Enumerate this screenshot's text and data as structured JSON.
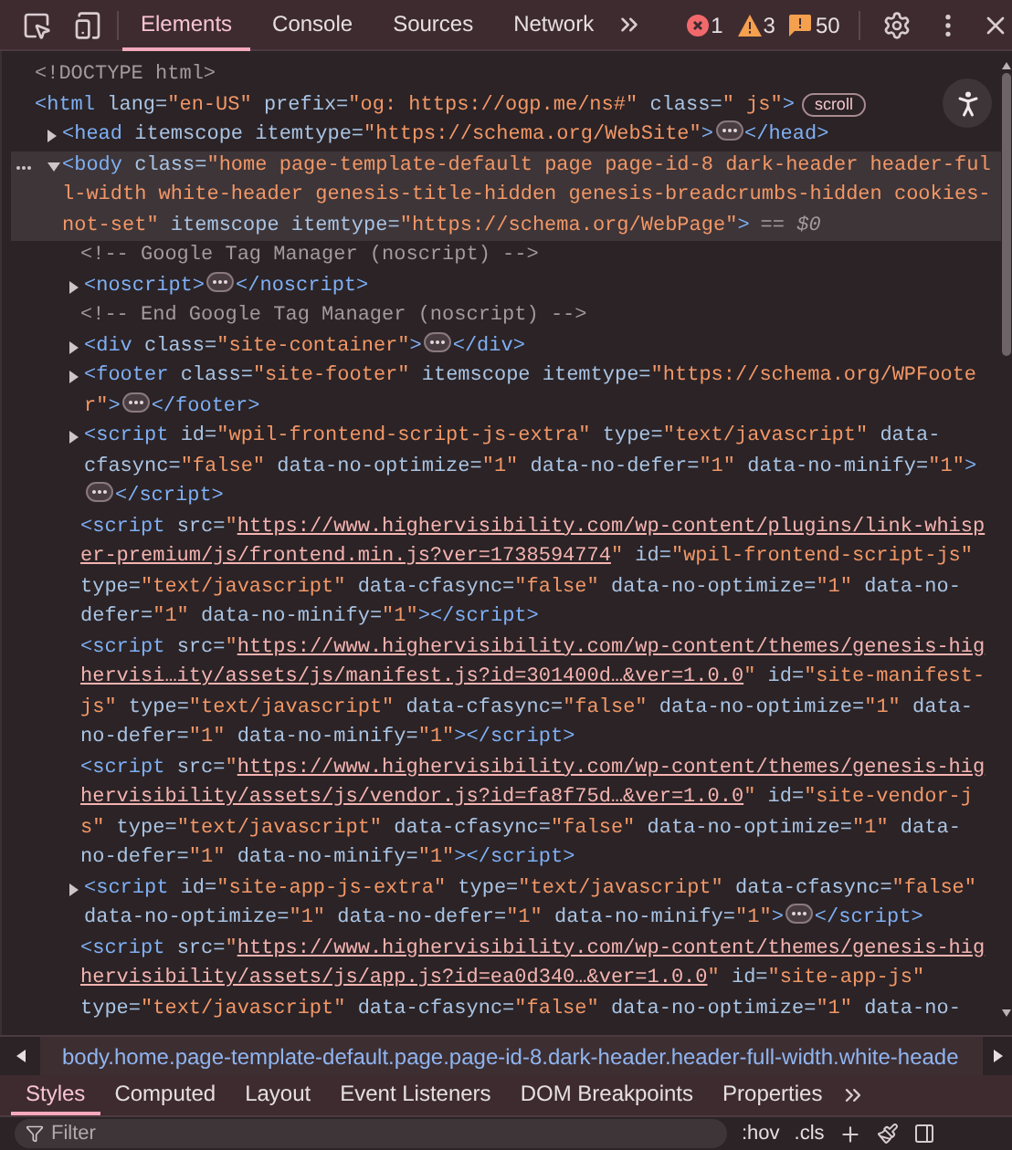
{
  "toolbar": {
    "tabs": [
      {
        "label": "Elements",
        "selected": true
      },
      {
        "label": "Console",
        "selected": false
      },
      {
        "label": "Sources",
        "selected": false
      },
      {
        "label": "Network",
        "selected": false
      }
    ],
    "errors": "1",
    "warnings": "3",
    "messages": "50"
  },
  "dom_tree": [
    {
      "selected": false,
      "tokens": [
        {
          "kind": "comment",
          "text": "<!DOCTYPE html>"
        }
      ]
    },
    {
      "selected": false,
      "tokens": [
        {
          "kind": "tag",
          "text": "<html"
        },
        {
          "kind": "attr",
          "text": " lang="
        },
        {
          "kind": "value",
          "text": "\"en-US\""
        },
        {
          "kind": "attr",
          "text": " prefix="
        },
        {
          "kind": "value",
          "text": "\"og: https://ogp.me/ns#\""
        },
        {
          "kind": "attr",
          "text": " class="
        },
        {
          "kind": "value",
          "text": "\" js\""
        },
        {
          "kind": "tag",
          "text": ">"
        },
        {
          "kind": "badge",
          "text": "scroll"
        }
      ],
      "children": [
        {
          "selected": false,
          "expanded": false,
          "tokens": [
            {
              "kind": "tag",
              "text": "<head"
            },
            {
              "kind": "attr",
              "text": " itemscope itemtype="
            },
            {
              "kind": "value",
              "text": "\"https://schema.org/WebSite\""
            },
            {
              "kind": "tag",
              "text": ">"
            },
            {
              "kind": "ellipsis"
            },
            {
              "kind": "tag",
              "text": "</head>"
            }
          ]
        },
        {
          "selected": true,
          "expanded": true,
          "tokens": [
            {
              "kind": "tag",
              "text": "<body"
            },
            {
              "kind": "attr",
              "text": " class="
            },
            {
              "kind": "value",
              "text": "\"home page-template-default page page-id-8 dark-header header-full-width white-header genesis-title-hidden genesis-breadcrumbs-hidden cookies-not-set\""
            },
            {
              "kind": "attr",
              "text": " itemscope itemtype="
            },
            {
              "kind": "value",
              "text": "\"https://schema.org/WebPage\""
            },
            {
              "kind": "tag",
              "text": ">"
            },
            {
              "kind": "marker",
              "text": "== $0"
            }
          ],
          "children": [
            {
              "selected": false,
              "tokens": [
                {
                  "kind": "comment",
                  "text": "<!-- Google Tag Manager (noscript) -->"
                }
              ]
            },
            {
              "selected": false,
              "expanded": false,
              "tokens": [
                {
                  "kind": "tag",
                  "text": "<noscript>"
                },
                {
                  "kind": "ellipsis"
                },
                {
                  "kind": "tag",
                  "text": "</noscript>"
                }
              ]
            },
            {
              "selected": false,
              "tokens": [
                {
                  "kind": "comment",
                  "text": "<!-- End Google Tag Manager (noscript) -->"
                }
              ]
            },
            {
              "selected": false,
              "expanded": false,
              "tokens": [
                {
                  "kind": "tag",
                  "text": "<div"
                },
                {
                  "kind": "attr",
                  "text": " class="
                },
                {
                  "kind": "value",
                  "text": "\"site-container\""
                },
                {
                  "kind": "tag",
                  "text": ">"
                },
                {
                  "kind": "ellipsis"
                },
                {
                  "kind": "tag",
                  "text": "</div>"
                }
              ]
            },
            {
              "selected": false,
              "expanded": false,
              "tokens": [
                {
                  "kind": "tag",
                  "text": "<footer"
                },
                {
                  "kind": "attr",
                  "text": " class="
                },
                {
                  "kind": "value",
                  "text": "\"site-footer\""
                },
                {
                  "kind": "attr",
                  "text": " itemscope itemtype="
                },
                {
                  "kind": "value",
                  "text": "\"https://schema.org/WPFooter\""
                },
                {
                  "kind": "tag",
                  "text": ">"
                },
                {
                  "kind": "ellipsis"
                },
                {
                  "kind": "tag",
                  "text": "</footer>"
                }
              ]
            },
            {
              "selected": false,
              "expanded": false,
              "tokens": [
                {
                  "kind": "tag",
                  "text": "<script"
                },
                {
                  "kind": "attr",
                  "text": " id="
                },
                {
                  "kind": "value",
                  "text": "\"wpil-frontend-script-js-extra\""
                },
                {
                  "kind": "attr",
                  "text": " type="
                },
                {
                  "kind": "value",
                  "text": "\"text/javascript\""
                },
                {
                  "kind": "attr",
                  "text": " data-cfasync="
                },
                {
                  "kind": "value",
                  "text": "\"false\""
                },
                {
                  "kind": "attr",
                  "text": " data-no-optimize="
                },
                {
                  "kind": "value",
                  "text": "\"1\""
                },
                {
                  "kind": "attr",
                  "text": " data-no-defer="
                },
                {
                  "kind": "value",
                  "text": "\"1\""
                },
                {
                  "kind": "attr",
                  "text": " data-no-minify="
                },
                {
                  "kind": "value",
                  "text": "\"1\""
                },
                {
                  "kind": "tag",
                  "text": ">"
                },
                {
                  "kind": "ellipsis"
                },
                {
                  "kind": "tag",
                  "text": "</script>"
                }
              ]
            },
            {
              "selected": false,
              "tokens": [
                {
                  "kind": "tag",
                  "text": "<script"
                },
                {
                  "kind": "attr",
                  "text": " src="
                },
                {
                  "kind": "value",
                  "text": "\""
                },
                {
                  "kind": "link",
                  "text": "https://www.highervisibility.com/wp-content/plugins/link-whisper-premium/js/frontend.min.js?ver=1738594774"
                },
                {
                  "kind": "value",
                  "text": "\""
                },
                {
                  "kind": "attr",
                  "text": " id="
                },
                {
                  "kind": "value",
                  "text": "\"wpil-frontend-script-js\""
                },
                {
                  "kind": "attr",
                  "text": " type="
                },
                {
                  "kind": "value",
                  "text": "\"text/javascript\""
                },
                {
                  "kind": "attr",
                  "text": " data-cfasync="
                },
                {
                  "kind": "value",
                  "text": "\"false\""
                },
                {
                  "kind": "attr",
                  "text": " data-no-optimize="
                },
                {
                  "kind": "value",
                  "text": "\"1\""
                },
                {
                  "kind": "attr",
                  "text": " data-no-defer="
                },
                {
                  "kind": "value",
                  "text": "\"1\""
                },
                {
                  "kind": "attr",
                  "text": " data-no-minify="
                },
                {
                  "kind": "value",
                  "text": "\"1\""
                },
                {
                  "kind": "tag",
                  "text": "></script>"
                }
              ]
            },
            {
              "selected": false,
              "tokens": [
                {
                  "kind": "tag",
                  "text": "<script"
                },
                {
                  "kind": "attr",
                  "text": " src="
                },
                {
                  "kind": "value",
                  "text": "\""
                },
                {
                  "kind": "link",
                  "text": "https://www.highervisibility.com/wp-content/themes/genesis-highervisi…ity/assets/js/manifest.js?id=301400d…&ver=1.0.0"
                },
                {
                  "kind": "value",
                  "text": "\""
                },
                {
                  "kind": "attr",
                  "text": " id="
                },
                {
                  "kind": "value",
                  "text": "\"site-manifest-js\""
                },
                {
                  "kind": "attr",
                  "text": " type="
                },
                {
                  "kind": "value",
                  "text": "\"text/javascript\""
                },
                {
                  "kind": "attr",
                  "text": " data-cfasync="
                },
                {
                  "kind": "value",
                  "text": "\"false\""
                },
                {
                  "kind": "attr",
                  "text": " data-no-optimize="
                },
                {
                  "kind": "value",
                  "text": "\"1\""
                },
                {
                  "kind": "attr",
                  "text": " data-no-defer="
                },
                {
                  "kind": "value",
                  "text": "\"1\""
                },
                {
                  "kind": "attr",
                  "text": " data-no-minify="
                },
                {
                  "kind": "value",
                  "text": "\"1\""
                },
                {
                  "kind": "tag",
                  "text": "></script>"
                }
              ]
            },
            {
              "selected": false,
              "tokens": [
                {
                  "kind": "tag",
                  "text": "<script"
                },
                {
                  "kind": "attr",
                  "text": " src="
                },
                {
                  "kind": "value",
                  "text": "\""
                },
                {
                  "kind": "link",
                  "text": "https://www.highervisibility.com/wp-content/themes/genesis-highervisibility/assets/js/vendor.js?id=fa8f75d…&ver=1.0.0"
                },
                {
                  "kind": "value",
                  "text": "\""
                },
                {
                  "kind": "attr",
                  "text": " id="
                },
                {
                  "kind": "value",
                  "text": "\"site-vendor-js\""
                },
                {
                  "kind": "attr",
                  "text": " type="
                },
                {
                  "kind": "value",
                  "text": "\"text/javascript\""
                },
                {
                  "kind": "attr",
                  "text": " data-cfasync="
                },
                {
                  "kind": "value",
                  "text": "\"false\""
                },
                {
                  "kind": "attr",
                  "text": " data-no-optimize="
                },
                {
                  "kind": "value",
                  "text": "\"1\""
                },
                {
                  "kind": "attr",
                  "text": " data-no-defer="
                },
                {
                  "kind": "value",
                  "text": "\"1\""
                },
                {
                  "kind": "attr",
                  "text": " data-no-minify="
                },
                {
                  "kind": "value",
                  "text": "\"1\""
                },
                {
                  "kind": "tag",
                  "text": "></script>"
                }
              ]
            },
            {
              "selected": false,
              "expanded": false,
              "tokens": [
                {
                  "kind": "tag",
                  "text": "<script"
                },
                {
                  "kind": "attr",
                  "text": " id="
                },
                {
                  "kind": "value",
                  "text": "\"site-app-js-extra\""
                },
                {
                  "kind": "attr",
                  "text": " type="
                },
                {
                  "kind": "value",
                  "text": "\"text/javascript\""
                },
                {
                  "kind": "attr",
                  "text": " data-cfasync="
                },
                {
                  "kind": "value",
                  "text": "\"false\""
                },
                {
                  "kind": "attr",
                  "text": " data-no-optimize="
                },
                {
                  "kind": "value",
                  "text": "\"1\""
                },
                {
                  "kind": "attr",
                  "text": " data-no-defer="
                },
                {
                  "kind": "value",
                  "text": "\"1\""
                },
                {
                  "kind": "attr",
                  "text": " data-no-minify="
                },
                {
                  "kind": "value",
                  "text": "\"1\""
                },
                {
                  "kind": "tag",
                  "text": ">"
                },
                {
                  "kind": "ellipsis"
                },
                {
                  "kind": "tag",
                  "text": "</script>"
                }
              ]
            },
            {
              "selected": false,
              "tokens": [
                {
                  "kind": "tag",
                  "text": "<script"
                },
                {
                  "kind": "attr",
                  "text": " src="
                },
                {
                  "kind": "value",
                  "text": "\""
                },
                {
                  "kind": "link",
                  "text": "https://www.highervisibility.com/wp-content/themes/genesis-highervisibility/assets/js/app.js?id=ea0d340…&ver=1.0.0"
                },
                {
                  "kind": "value",
                  "text": "\""
                },
                {
                  "kind": "attr",
                  "text": " id="
                },
                {
                  "kind": "value",
                  "text": "\"site-app-js\""
                },
                {
                  "kind": "attr",
                  "text": " type="
                },
                {
                  "kind": "value",
                  "text": "\"text/javascript\""
                },
                {
                  "kind": "attr",
                  "text": " data-cfasync="
                },
                {
                  "kind": "value",
                  "text": "\"false\""
                },
                {
                  "kind": "attr",
                  "text": " data-no-optimize="
                },
                {
                  "kind": "value",
                  "text": "\"1\""
                },
                {
                  "kind": "attr",
                  "text": " data-no-"
                }
              ]
            }
          ]
        }
      ]
    }
  ],
  "breadcrumb": "body.home.page-template-default.page.page-id-8.dark-header.header-full-width.white-heade",
  "sidebar_tabs": [
    {
      "label": "Styles",
      "selected": true
    },
    {
      "label": "Computed",
      "selected": false
    },
    {
      "label": "Layout",
      "selected": false
    },
    {
      "label": "Event Listeners",
      "selected": false
    },
    {
      "label": "DOM Breakpoints",
      "selected": false
    },
    {
      "label": "Properties",
      "selected": false
    }
  ],
  "filter": {
    "placeholder": "Filter"
  },
  "style_buttons": [
    ":hov",
    ".cls"
  ]
}
